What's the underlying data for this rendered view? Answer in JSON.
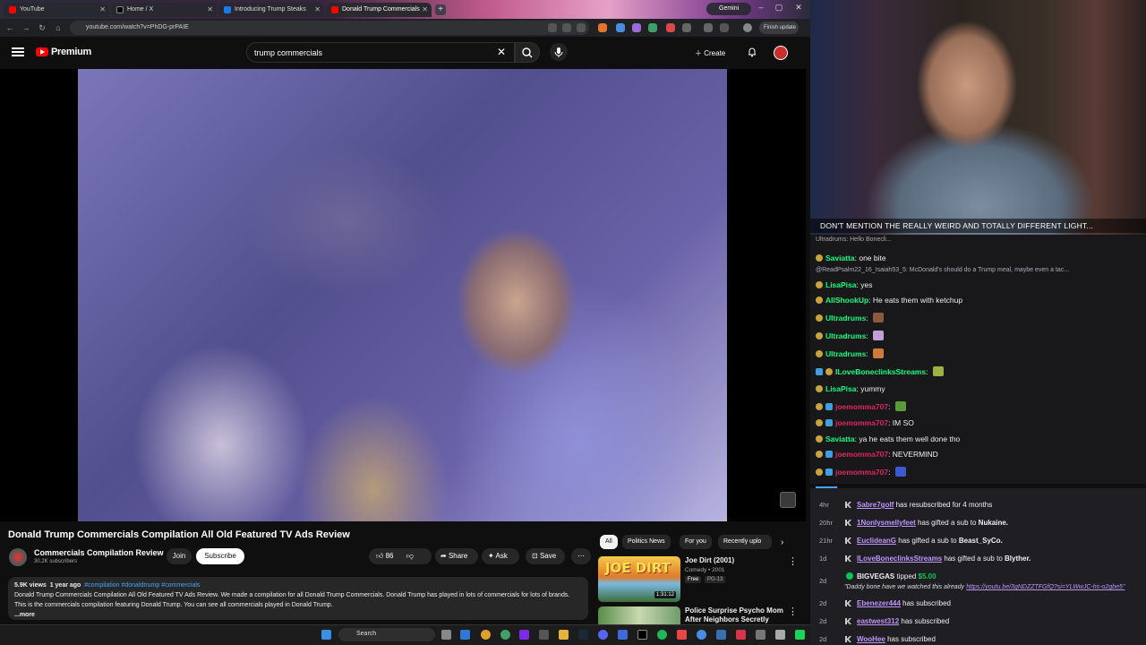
{
  "browser": {
    "tabs": [
      {
        "label": "YouTube",
        "active": false
      },
      {
        "label": "Home / X",
        "active": false
      },
      {
        "label": "Introducing Trump Steaks",
        "active": false
      },
      {
        "label": "Donald Trump Commercials",
        "active": true
      }
    ],
    "gemini_label": "Gemini",
    "url": "youtube.com/watch?v=PhDG-prPAIE",
    "finish_update": "Finish update"
  },
  "youtube": {
    "brand": "Premium",
    "search_value": "trump commercials",
    "create_label": "Create"
  },
  "video": {
    "title": "Donald Trump Commercials Compilation All Old Featured TV Ads Review",
    "channel": "Commercials Compilation Review",
    "subscribers": "30.2K subscribers",
    "join_label": "Join",
    "subscribe_label": "Subscribe",
    "likes": "86",
    "share_label": "Share",
    "ask_label": "Ask",
    "save_label": "Save",
    "views": "5.9K views",
    "age": "1 year ago",
    "tags": "#compilation #donaldtrump #commercials",
    "description": "Donald Trump Commercials Compilation All Old Featured TV Ads Review. We made a compilation for all Donald Trump Commercials. Donald Trump has played in lots of commercials for lots of brands. This is the commercials compilation featuring Donald Trump. You can see all commercials played in Donald Trump.",
    "more_label": "...more"
  },
  "recommendations": {
    "chips": [
      "All",
      "Politics News",
      "For you",
      "Recently uplo"
    ],
    "items": [
      {
        "title": "Joe Dirt (2001)",
        "meta": "Comedy • 2001",
        "free": "Free",
        "rating": "PG-13",
        "duration": "1:31:12",
        "thumb_text": "JOE DIRT"
      },
      {
        "title": "Police Surprise Psycho Mom After Neighbors Secretly Call ..."
      }
    ]
  },
  "taskbar": {
    "search_label": "Search"
  },
  "stream": {
    "banner": "DON'T MENTION THE REALLY WEIRD AND TOTALLY DIFFERENT LIGHT..."
  },
  "chat": {
    "top_partial": "Ultradrums: Hello Bonecli...",
    "reply_context": "@ReadPsalm22_16_Isaiah53_5: McDonald's should do a Trump meal, maybe even a tac...",
    "messages": [
      {
        "user": "Saviatta",
        "text": "one bite",
        "color": "#00ff7f"
      },
      {
        "user": "LisaPisa",
        "text": "yes",
        "color": "#00ff7f"
      },
      {
        "user": "AllShookUp",
        "text": "He eats them with ketchup",
        "color": "#00ff7f"
      },
      {
        "user": "Ultradrums",
        "text": "",
        "color": "#00ff7f"
      },
      {
        "user": "Ultradrums",
        "text": "",
        "color": "#00ff7f"
      },
      {
        "user": "Ultradrums",
        "text": "",
        "color": "#00ff7f"
      },
      {
        "user": "ILoveBoneclinksStreams",
        "text": "",
        "color": "#00ff7f"
      },
      {
        "user": "LisaPisa",
        "text": "yummy",
        "color": "#00ff7f"
      },
      {
        "user": "joemomma707",
        "text": "",
        "color": "#e0245e"
      },
      {
        "user": "joemomma707",
        "text": "IM SO",
        "color": "#e0245e"
      },
      {
        "user": "Saviatta",
        "text": "ya he eats them well done tho",
        "color": "#00ff7f"
      },
      {
        "user": "joemomma707",
        "text": "NEVERMIND",
        "color": "#e0245e"
      },
      {
        "user": "joemomma707",
        "text": "",
        "color": "#e0245e"
      }
    ]
  },
  "events": [
    {
      "time": "4hr",
      "name": "Sabre7golf",
      "action": "has resubscribed for 4 months"
    },
    {
      "time": "20hr",
      "name": "1Nonlysmellyfeet",
      "action": "has gifted a sub to",
      "target": "Nukaine."
    },
    {
      "time": "21hr",
      "name": "EuclideanG",
      "action": "has gifted a sub to",
      "target": "Beast_SyCo."
    },
    {
      "time": "1d",
      "name": "ILoveBoneclinksStreams",
      "action": "has gifted a sub to",
      "target": "Blyther."
    },
    {
      "time": "2d",
      "name": "BIGVEGAS",
      "action": "tipped",
      "amount": "$5.00",
      "quote": "\"Daddy bone have we watched this already",
      "link": "https://youtu.be/3gNDZZTFGfQ?si=YLWwJC-hs-o2gbe5\""
    },
    {
      "time": "2d",
      "name": "Ebenezer444",
      "action": "has subscribed"
    },
    {
      "time": "2d",
      "name": "eastwest312",
      "action": "has subscribed"
    },
    {
      "time": "2d",
      "name": "WooHee",
      "action": "has subscribed"
    }
  ]
}
